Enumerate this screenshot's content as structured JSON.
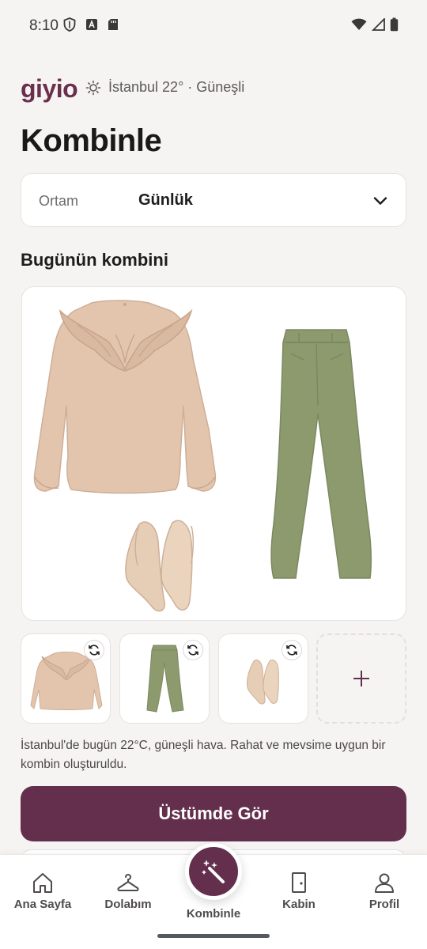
{
  "status_bar": {
    "time": "8:10"
  },
  "header": {
    "brand": "giyio",
    "weather_icon": "sun-icon",
    "weather_text": "İstanbul 22° · Güneşli"
  },
  "page_title": "Kombinle",
  "setting": {
    "label": "Ortam",
    "value": "Günlük"
  },
  "section_title": "Bugünün kombini",
  "outfit": {
    "items": [
      {
        "name": "Fırfırlı bluz",
        "color": "#e3c5ae"
      },
      {
        "name": "Yeşil pantolon",
        "color": "#8d9a6e"
      },
      {
        "name": "Nude topuklu ayakkabı",
        "color": "#e6cdb5"
      }
    ]
  },
  "description": "İstanbul'de bugün 22°C, güneşli hava. Rahat ve mevsime uygun bir kombin oluşturuldu.",
  "primary_button": "Üstümde Gör",
  "nav": {
    "items": [
      {
        "label": "Ana Sayfa",
        "icon": "home-icon"
      },
      {
        "label": "Dolabım",
        "icon": "hanger-icon"
      },
      {
        "label": "Kombinle",
        "icon": "magic-wand-icon"
      },
      {
        "label": "Kabin",
        "icon": "door-icon"
      },
      {
        "label": "Profil",
        "icon": "user-icon"
      }
    ]
  },
  "colors": {
    "accent": "#632f4d",
    "brand": "#6a2f4d",
    "background": "#f6f4f2"
  }
}
